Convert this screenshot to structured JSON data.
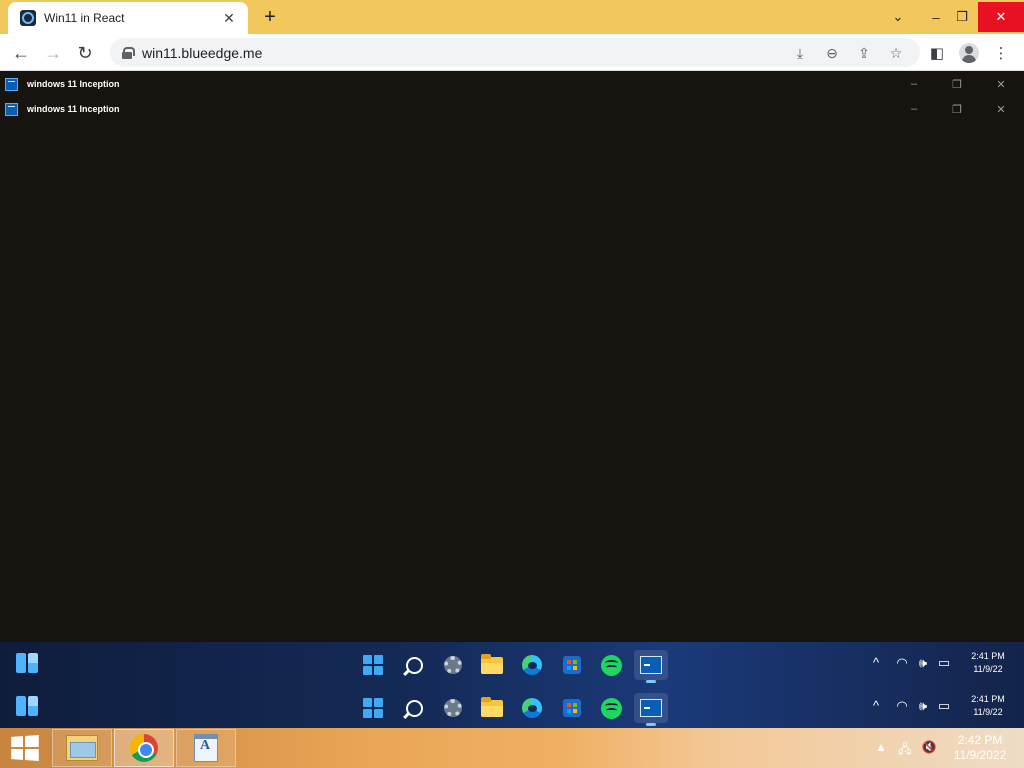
{
  "browser": {
    "tab_title": "Win11 in React",
    "tab_close_glyph": "✕",
    "new_tab_glyph": "+",
    "url": "win11.blueedge.me",
    "window_controls": {
      "tabs_menu": "⌄",
      "minimize": "–",
      "restore": "❐",
      "close": "✕"
    },
    "nav": {
      "back": "←",
      "forward": "→",
      "reload": "↻"
    },
    "omnibox_icons": [
      "download-icon",
      "zoom-out-icon",
      "share-icon",
      "bookmark-star-icon"
    ],
    "colors": {
      "frame": "#f2c75c",
      "close_hover": "#e81123"
    }
  },
  "page": {
    "windows": [
      {
        "title": "windows 11 Inception",
        "controls": {
          "minimize": "–",
          "maximize": "❐",
          "close": "✕"
        }
      },
      {
        "title": "windows 11 Inception",
        "controls": {
          "minimize": "–",
          "maximize": "❐",
          "close": "✕"
        }
      }
    ],
    "background_color": "#17140f"
  },
  "win11_taskbars": [
    {
      "apps": [
        "start",
        "search",
        "settings",
        "file-explorer",
        "edge",
        "store",
        "spotify",
        "terminal"
      ],
      "active_app": "terminal",
      "tray": {
        "chevron": "^",
        "wifi": "wifi-icon",
        "volume": "volume-icon",
        "battery": "battery-icon"
      },
      "time": "2:41 PM",
      "date": "11/9/22"
    },
    {
      "apps": [
        "start",
        "search",
        "settings",
        "file-explorer",
        "edge",
        "store",
        "spotify",
        "terminal"
      ],
      "active_app": "terminal",
      "tray": {
        "chevron": "^",
        "wifi": "wifi-icon",
        "volume": "volume-icon",
        "battery": "battery-icon"
      },
      "time": "2:41 PM",
      "date": "11/9/22"
    }
  ],
  "host_taskbar": {
    "pinned": [
      "file-explorer",
      "google-chrome",
      "wordpad"
    ],
    "active": "google-chrome",
    "tray": {
      "chevron": "▲",
      "network": "network-icon",
      "volume": "volume-muted-icon"
    },
    "time": "2:42 PM",
    "date": "11/9/2022"
  }
}
